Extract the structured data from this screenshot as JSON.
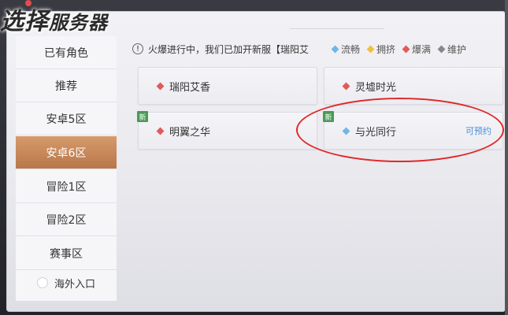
{
  "header": {
    "title_big": "选择",
    "title_small": "服务器"
  },
  "sidebar": {
    "items": [
      {
        "label": "已有角色",
        "active": false
      },
      {
        "label": "推荐",
        "active": false
      },
      {
        "label": "安卓5区",
        "active": false
      },
      {
        "label": "安卓6区",
        "active": true
      },
      {
        "label": "冒险1区",
        "active": false
      },
      {
        "label": "冒险2区",
        "active": false
      },
      {
        "label": "赛事区",
        "active": false
      }
    ],
    "overseas_label": "海外入口"
  },
  "notice": {
    "icon": "!",
    "text": "火爆进行中，我们已加开新服【瑞阳艾"
  },
  "legend": [
    {
      "label": "流畅",
      "color": "#6fb7e6"
    },
    {
      "label": "拥挤",
      "color": "#f0c040"
    },
    {
      "label": "爆满",
      "color": "#e05a5a"
    },
    {
      "label": "维护",
      "color": "#888888"
    }
  ],
  "servers": [
    {
      "name": "瑞阳艾香",
      "status_color": "#e05a5a",
      "is_new": false,
      "tag": ""
    },
    {
      "name": "灵墟时光",
      "status_color": "#e05a5a",
      "is_new": false,
      "tag": ""
    },
    {
      "name": "明翼之华",
      "status_color": "#e05a5a",
      "is_new": true,
      "tag": ""
    },
    {
      "name": "与光同行",
      "status_color": "#6fb7e6",
      "is_new": true,
      "tag": "可预约"
    }
  ],
  "new_label": "新",
  "colors": {
    "active_tab": "#c6875a",
    "reserve_text": "#4a8fd8",
    "highlight": "#e02828"
  }
}
